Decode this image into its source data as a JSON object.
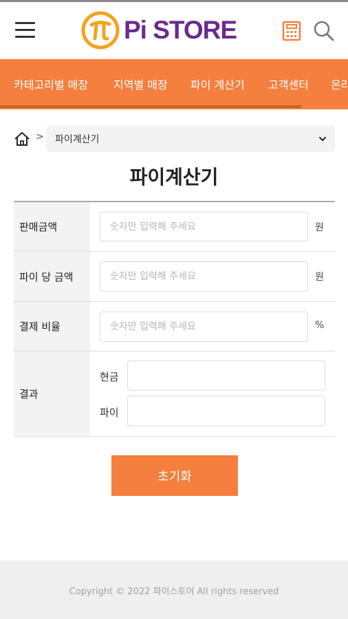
{
  "header": {
    "logo_text": "Pi STORE",
    "brand_color": "#6a2a8e",
    "accent_color": "#f47f3e",
    "icons": [
      "menu-icon",
      "pi-logo-icon",
      "calculator-icon",
      "search-icon"
    ]
  },
  "nav": {
    "items": [
      {
        "label": "카테고리별 매장"
      },
      {
        "label": "지역별 매장"
      },
      {
        "label": "파이 계산기"
      },
      {
        "label": "고객센터"
      },
      {
        "label": "온라"
      }
    ]
  },
  "breadcrumb": {
    "separator": ">",
    "current": "파이계산기"
  },
  "page": {
    "title": "파이계산기"
  },
  "form": {
    "sale_amount": {
      "label": "판매금액",
      "placeholder": "숫자만 입력해 주세요",
      "value": "",
      "unit": "원"
    },
    "price_per_pi": {
      "label": "파이 당 금액",
      "placeholder": "숫자만 입력해 주세요",
      "value": "",
      "unit": "원"
    },
    "payment_ratio": {
      "label": "결제 비율",
      "placeholder": "숫자만 입력해 주세요",
      "value": "",
      "unit": "%"
    },
    "result": {
      "label": "결과",
      "cash_label": "현금",
      "cash_value": "",
      "pi_label": "파이",
      "pi_value": ""
    }
  },
  "reset_label": "초기화",
  "footer": {
    "copyright": "Copyright © 2022 파이스토어 All rights reserved"
  }
}
